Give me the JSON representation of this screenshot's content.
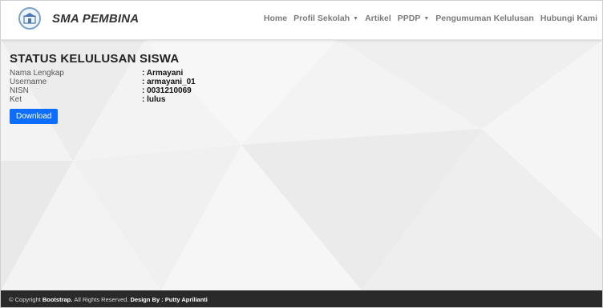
{
  "navbar": {
    "brand": "SMA PEMBINA",
    "logo_icon": "school-crest-icon",
    "items": [
      {
        "label": "Home",
        "dropdown": false
      },
      {
        "label": "Profil Sekolah",
        "dropdown": true
      },
      {
        "label": "Artikel",
        "dropdown": false
      },
      {
        "label": "PPDP",
        "dropdown": true
      },
      {
        "label": "Pengumuman Kelulusan",
        "dropdown": false
      },
      {
        "label": "Hubungi Kami",
        "dropdown": false
      }
    ]
  },
  "main": {
    "title": "STATUS KELULUSAN SISWA",
    "fields": [
      {
        "label": "Nama Lengkap",
        "value": ": Armayani"
      },
      {
        "label": "Username",
        "value": ": armayani_01"
      },
      {
        "label": "NISN",
        "value": ": 0031210069"
      },
      {
        "label": "Ket",
        "value": ": lulus"
      }
    ],
    "download_label": "Download"
  },
  "footer": {
    "copyright_symbol": "©",
    "copyright": "Copyright",
    "brand": "Bootstrap.",
    "rights": "All Rights Reserved.",
    "design_by": "Design By : Putty Aprilianti"
  },
  "colors": {
    "primary": "#0d6efd",
    "footer_bg": "#2a2a2a",
    "page_bg": "#f3f3f3"
  }
}
